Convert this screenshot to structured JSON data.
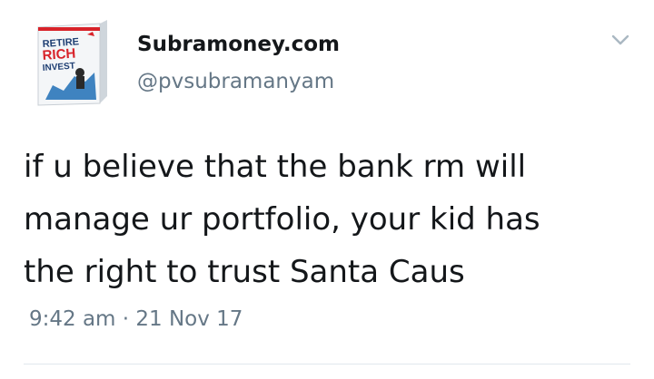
{
  "tweet": {
    "author": {
      "display_name": "Subramoney.com",
      "handle": "@pvsubramanyam",
      "avatar": {
        "icon": "book-cover-avatar-icon",
        "logo_lines": [
          "RETIRE",
          "RICH",
          "INVEST"
        ]
      }
    },
    "menu_icon": "chevron-down-icon",
    "text_lines": [
      "if u believe that the bank rm will",
      "manage ur portfolio, your kid has",
      "the right to trust Santa Caus"
    ],
    "timestamp": "9:42 am · 21 Nov 17"
  },
  "colors": {
    "text_primary": "#14171a",
    "text_secondary": "#657786",
    "divider": "#e1e8ed",
    "avatar_red": "#d8232a",
    "avatar_blue": "#1f6fb6"
  }
}
